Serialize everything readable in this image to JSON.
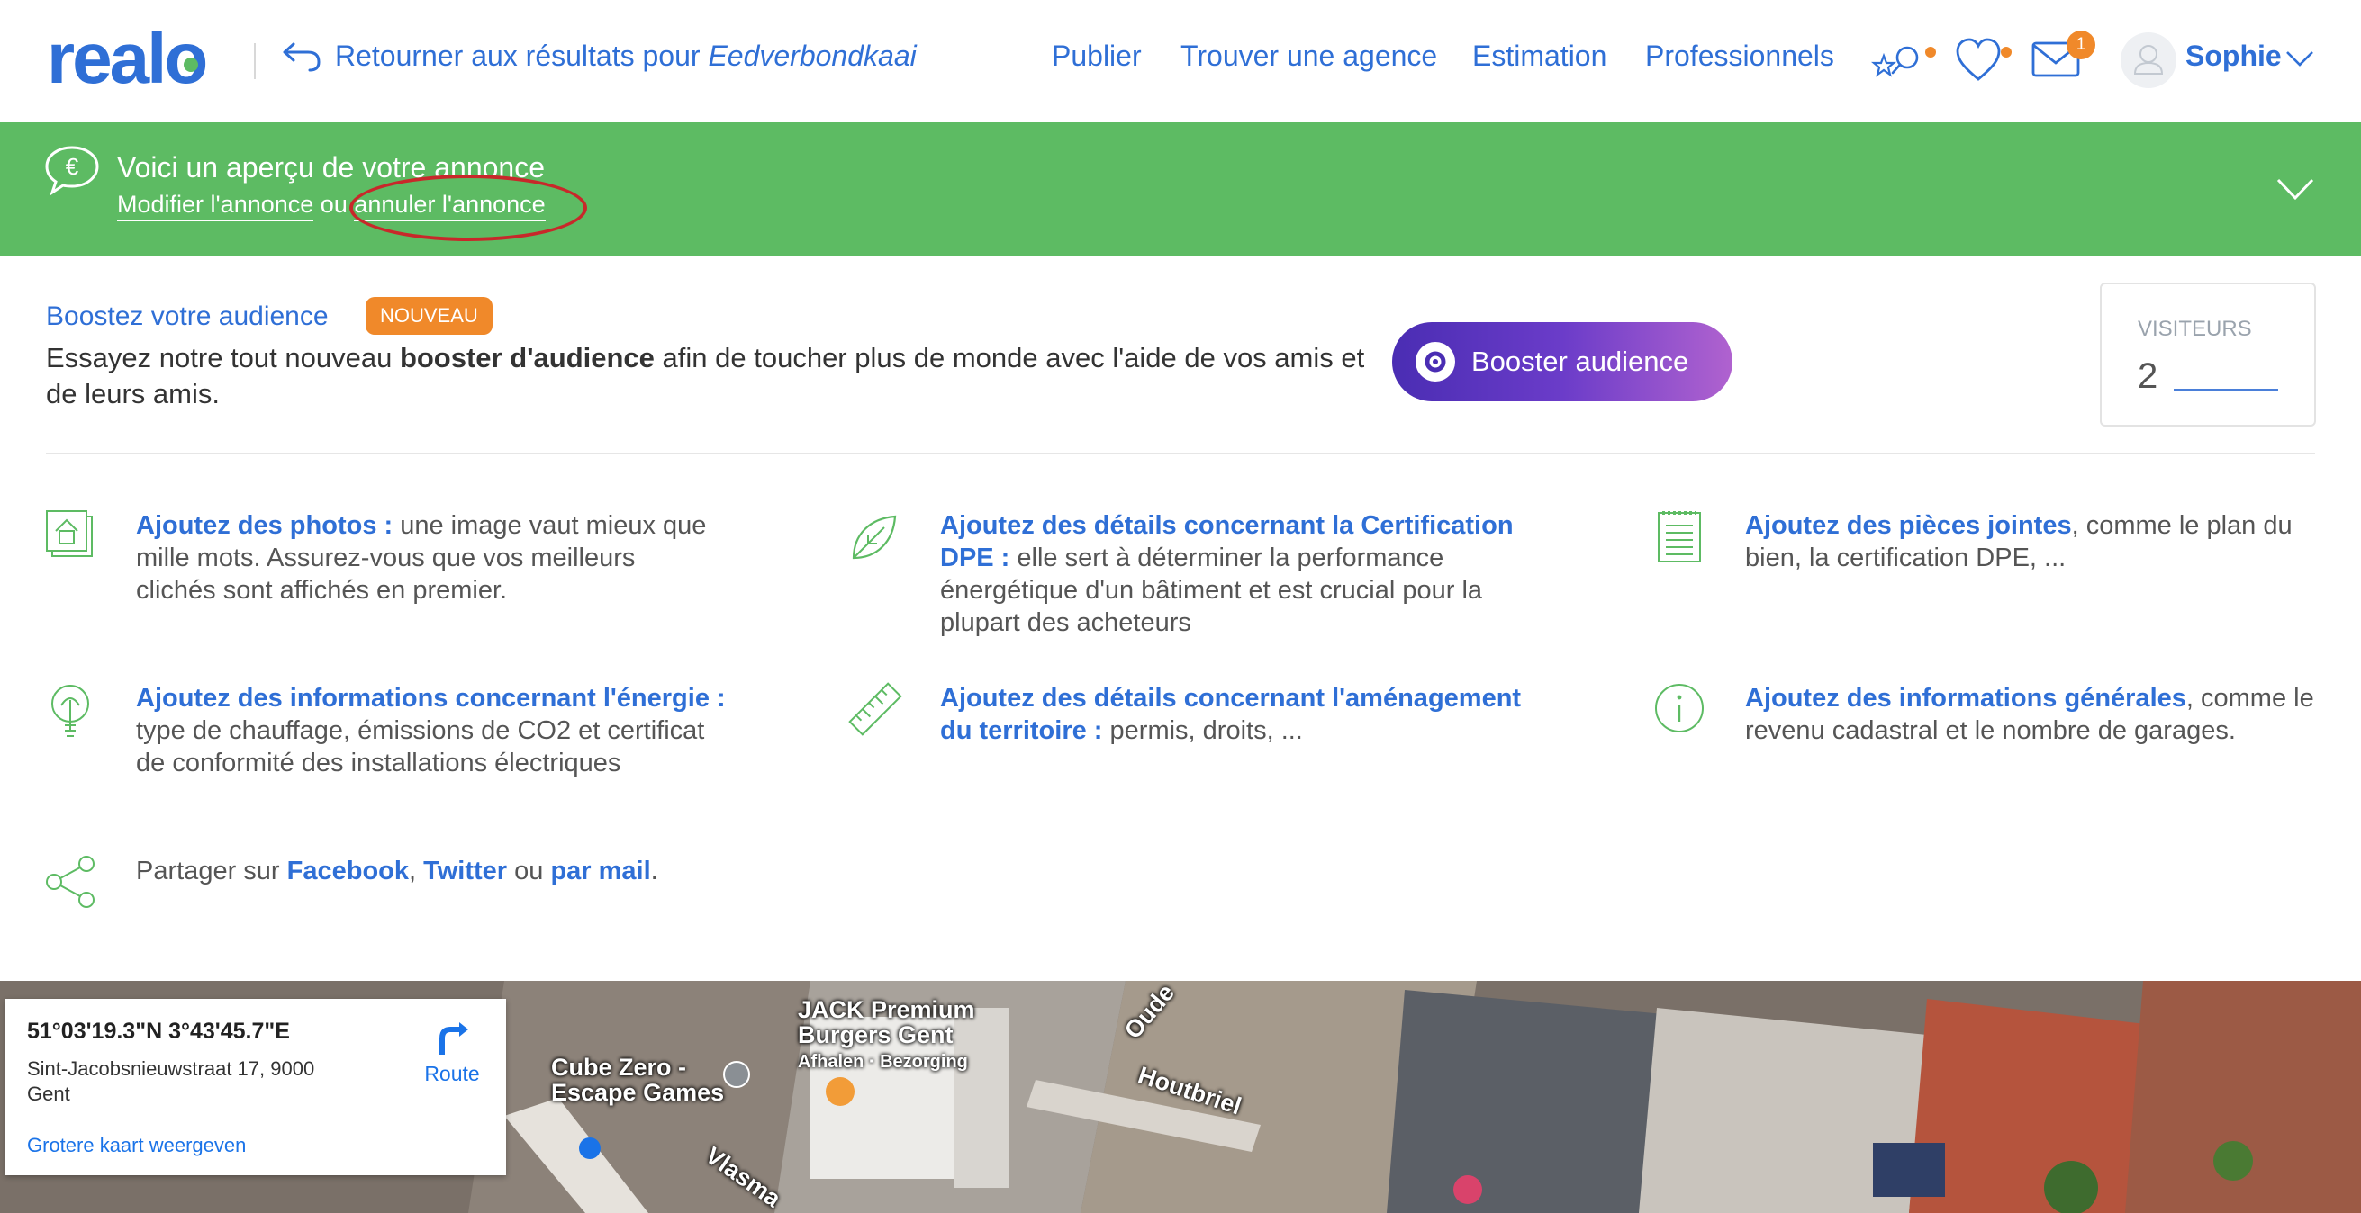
{
  "header": {
    "logo": "realo",
    "back_text": "Retourner aux résultats pour",
    "back_query": "Eedverbondkaai",
    "nav": [
      "Publier",
      "Trouver une agence",
      "Estimation",
      "Professionnels"
    ],
    "messages_count": "1",
    "user_name": "Sophie",
    "accent_color": "#2f6fd6",
    "badge_color": "#f0892a"
  },
  "banner": {
    "title": "Voici un aperçu de votre annonce",
    "edit_link": "Modifier l'annonce",
    "or": "ou",
    "cancel_link": "annuler l'annonce",
    "bg_color": "#5dbb63"
  },
  "boost": {
    "title": "Boostez votre audience",
    "badge": "NOUVEAU",
    "text_before": "Essayez notre tout nouveau",
    "text_bold": "booster d'audience",
    "text_after": "afin de toucher plus de monde avec l'aide de vos amis et de leurs amis.",
    "button": "Booster audience"
  },
  "visitors": {
    "label": "VISITEURS",
    "value": "2"
  },
  "tips": [
    {
      "icon": "photo-house-icon",
      "link": "Ajoutez des photos :",
      "text": "une image vaut mieux que mille mots. Assurez-vous que vos meilleurs clichés sont affichés en premier."
    },
    {
      "icon": "leaf-icon",
      "link": "Ajoutez des détails concernant la Certification DPE :",
      "text": "elle sert à déterminer la performance énergétique d'un bâtiment et est crucial pour la plupart des acheteurs"
    },
    {
      "icon": "document-icon",
      "link": "Ajoutez des pièces jointes",
      "text": ", comme le plan du bien, la certification DPE, ..."
    },
    {
      "icon": "lightbulb-icon",
      "link": "Ajoutez des informations concernant l'énergie :",
      "text": "type de chauffage, émissions de CO2 et certificat de conformité des installations électriques"
    },
    {
      "icon": "ruler-icon",
      "link": "Ajoutez des détails concernant l'aménagement du territoire :",
      "text": "permis, droits, ..."
    },
    {
      "icon": "info-icon",
      "link": "Ajoutez des informations générales",
      "text": ", comme le revenu cadastral et le nombre de garages."
    }
  ],
  "share": {
    "prefix": "Partager sur",
    "facebook": "Facebook",
    "comma": ",",
    "twitter": "Twitter",
    "or": "ou",
    "mail": "par mail",
    "end": "."
  },
  "map": {
    "coordinates": "51°03'19.3\"N 3°43'45.7\"E",
    "address": "Sint-Jacobsnieuwstraat 17, 9000 Gent",
    "route": "Route",
    "bigger_map": "Grotere kaart weergeven",
    "labels": {
      "cube_zero": "Cube Zero -\nEscape Games",
      "jack": "JACK Premium\nBurgers Gent",
      "jack_sub": "Afhalen · Bezorging",
      "houtbriel": "Houtbriel",
      "oude": "Oude",
      "vlasmarkt": "Vlasma"
    }
  }
}
